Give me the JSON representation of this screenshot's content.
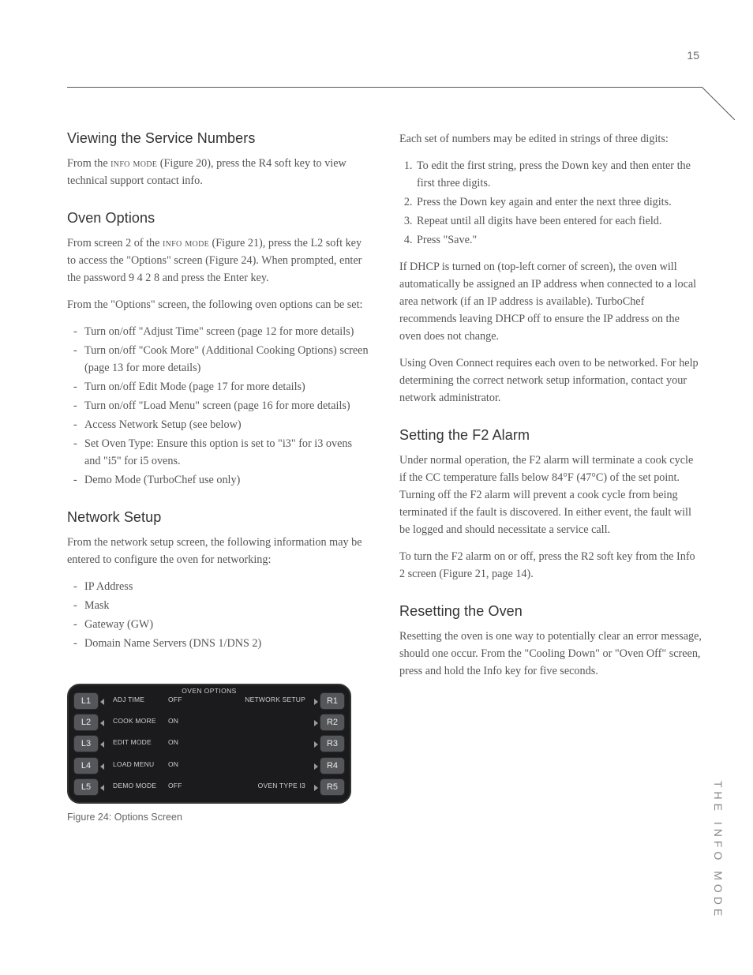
{
  "page_number": "15",
  "side_label": "THE INFO MODE",
  "left": {
    "h_viewing": "Viewing the Service Numbers",
    "p_viewing_pre": "From the ",
    "p_viewing_sc": "info mode",
    "p_viewing_post": " (Figure 20), press the R4 soft key to view technical support contact info.",
    "h_oven": "Oven Options",
    "p_oven1_pre": "From screen 2 of the ",
    "p_oven1_sc": "info mode",
    "p_oven1_post": " (Figure 21), press the L2 soft key to access the \"Options\" screen (Figure 24). When prompted, enter the password 9  4  2  8 and press the Enter key.",
    "p_oven2": "From the \"Options\" screen, the following oven options can be set:",
    "oven_list": [
      "Turn on/off \"Adjust Time\" screen (page 12 for more details)",
      "Turn on/off \"Cook More\" (Additional Cooking Options) screen (page 13 for more details)",
      "Turn on/off Edit Mode (page 17 for more details)",
      "Turn on/off \"Load Menu\" screen (page 16 for more details)",
      "Access Network Setup (see below)",
      "Set Oven Type: Ensure this option is set to \"i3\" for i3 ovens and \"i5\" for i5 ovens.",
      "Demo Mode (TurboChef use only)"
    ],
    "h_network": "Network Setup",
    "p_network": "From the network setup screen, the following information may be entered to configure the oven for networking:",
    "net_list": [
      "IP Address",
      "Mask",
      "Gateway (GW)",
      "Domain Name Servers (DNS 1/DNS 2)"
    ]
  },
  "right": {
    "p_intro": "Each set of numbers may be edited in strings of three digits:",
    "steps": [
      "To edit the first string, press the Down key and then enter the first three digits.",
      "Press the Down key again and enter the next three digits.",
      "Repeat until all digits have been entered for each field.",
      "Press \"Save.\""
    ],
    "p_dhcp": "If DHCP is turned on (top-left corner of screen), the oven will automatically be assigned an IP address when connected to a local area network (if an IP address is available). TurboChef recommends leaving DHCP off to ensure the IP address on the oven does not change.",
    "p_connect": "Using Oven Connect requires each oven to be networked. For help determining the correct network setup information, contact your network administrator.",
    "h_f2": "Setting the F2 Alarm",
    "p_f2a": "Under normal operation, the F2 alarm will terminate a cook cycle if the CC temperature falls below 84°F (47°C) of the set point. Turning off the F2 alarm will prevent a cook cycle from being terminated if the fault is discovered. In either event, the fault will be logged and should necessitate a service call.",
    "p_f2b": "To turn the F2 alarm on or off, press the R2 soft key from the Info 2 screen (Figure 21, page 14).",
    "h_reset": "Resetting the Oven",
    "p_reset": "Resetting the oven is one way to potentially clear an error message, should one occur. From the \"Cooling Down\" or \"Oven Off\" screen, press and hold the Info key for five seconds."
  },
  "figure": {
    "caption": "Figure 24: Options Screen",
    "title": "OVEN OPTIONS",
    "left_keys": [
      "L1",
      "L2",
      "L3",
      "L4",
      "L5"
    ],
    "right_keys": [
      "R1",
      "R2",
      "R3",
      "R4",
      "R5"
    ],
    "rows": [
      {
        "a": "ADJ TIME",
        "b": "OFF",
        "r": "NETWORK SETUP"
      },
      {
        "a": "COOK MORE",
        "b": "ON",
        "r": ""
      },
      {
        "a": "EDIT MODE",
        "b": "ON",
        "r": ""
      },
      {
        "a": "LOAD MENU",
        "b": "ON",
        "r": ""
      },
      {
        "a": "DEMO MODE",
        "b": "OFF",
        "r": "OVEN TYPE I3"
      }
    ]
  }
}
